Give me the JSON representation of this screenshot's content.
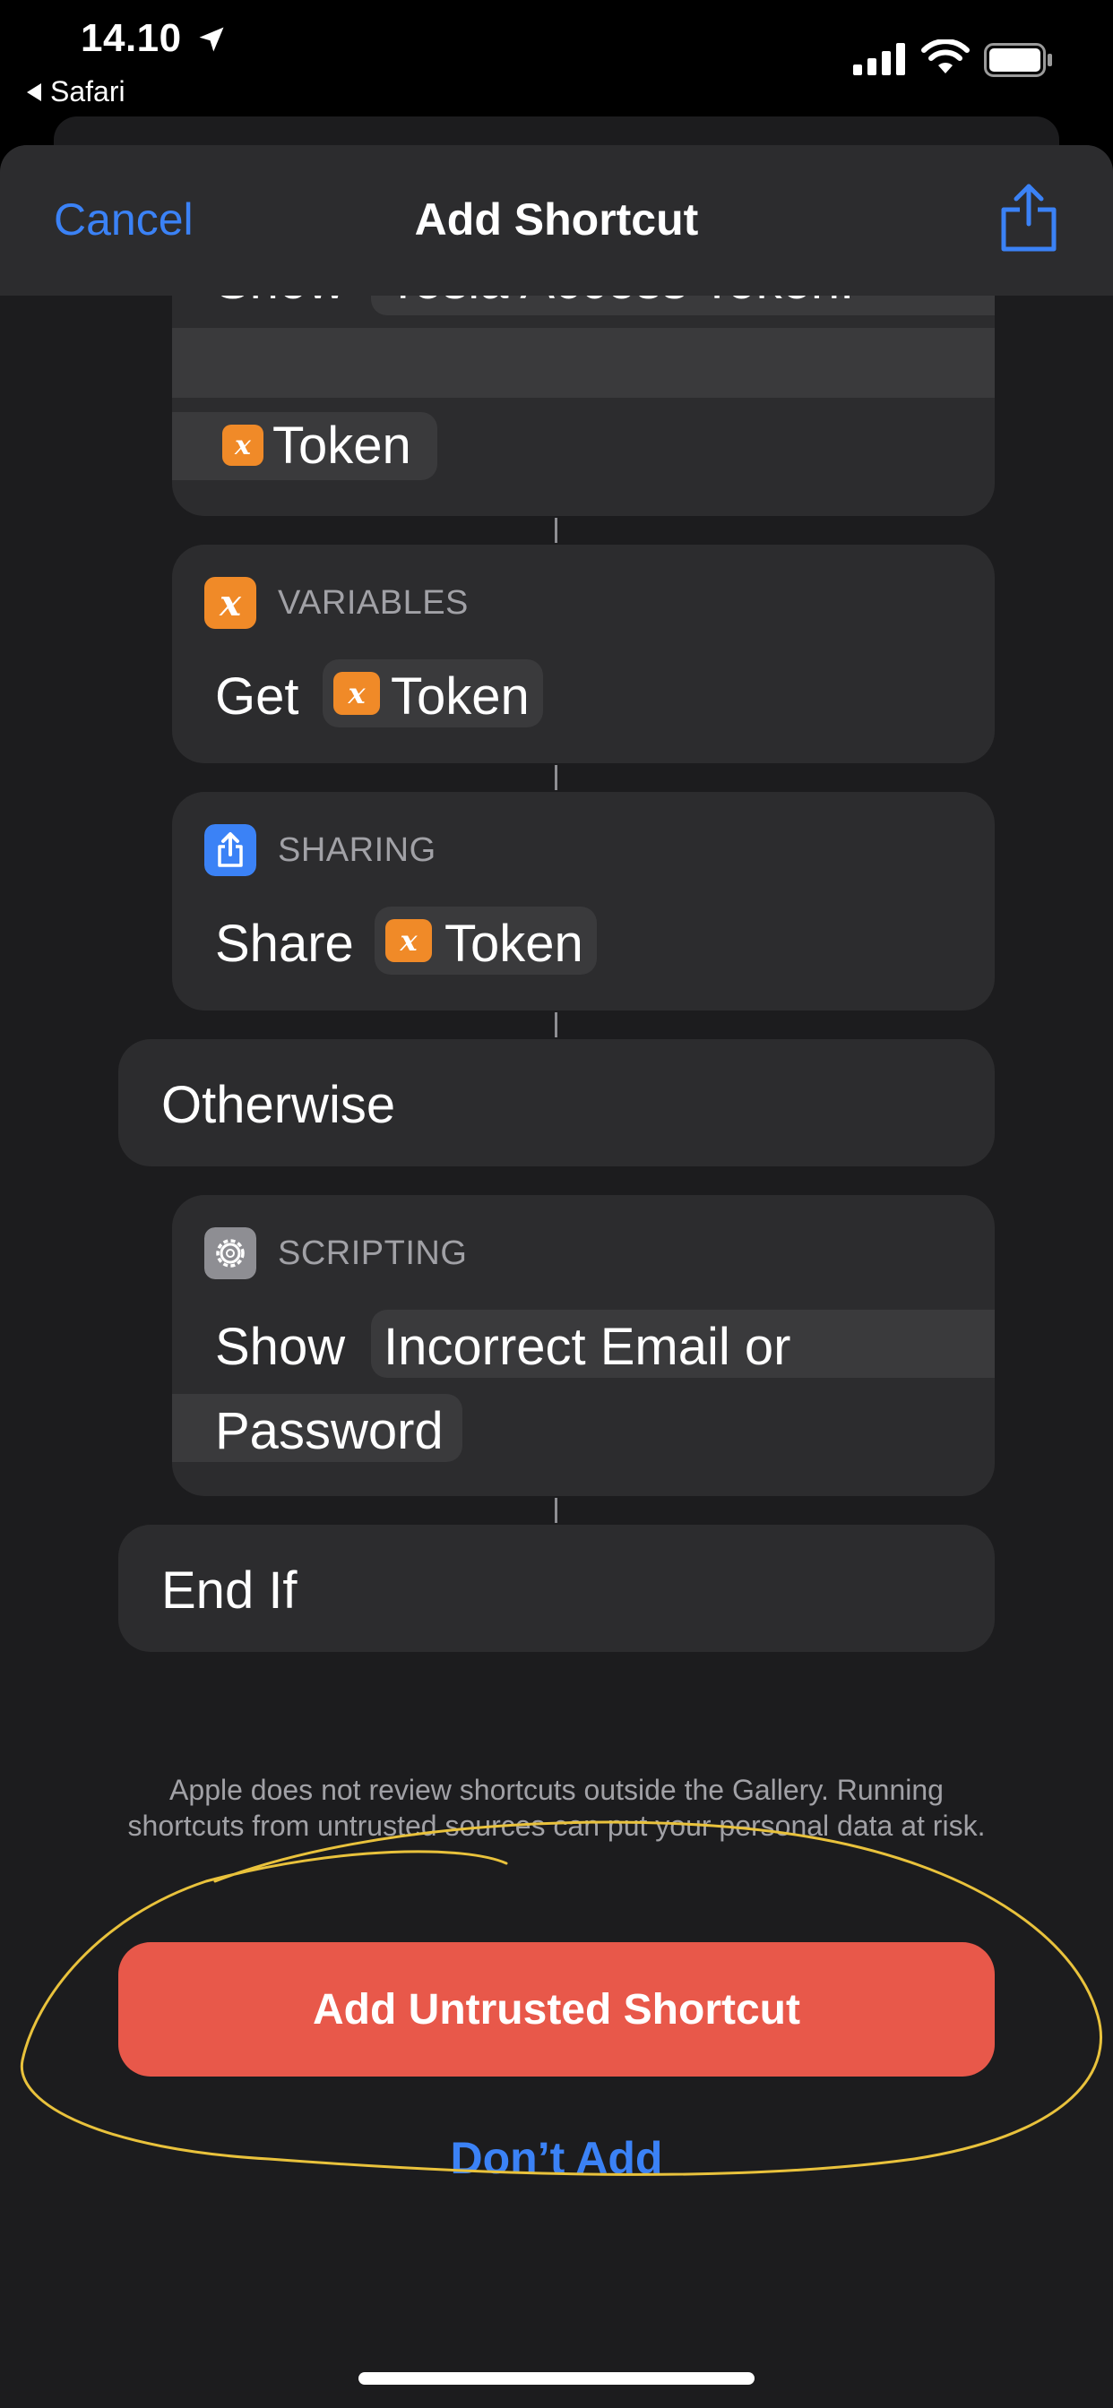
{
  "status_bar": {
    "time": "14.10",
    "back_app": "Safari"
  },
  "nav": {
    "cancel": "Cancel",
    "title": "Add Shortcut"
  },
  "partial_block": {
    "show_label": "Show",
    "show_value": "Tesla Access Token:",
    "token_label": "Token"
  },
  "variables_action": {
    "category": "VARIABLES",
    "verb": "Get",
    "token_label": "Token"
  },
  "sharing_action": {
    "category": "SHARING",
    "verb": "Share",
    "token_label": "Token"
  },
  "otherwise_block": {
    "label": "Otherwise"
  },
  "scripting_action": {
    "category": "SCRIPTING",
    "verb": "Show",
    "text_line1": "Incorrect Email or",
    "text_line2": "Password"
  },
  "end_if_block": {
    "label": "End If"
  },
  "notice": "Apple does not review shortcuts outside the Gallery. Running shortcuts from untrusted sources can put your personal data at risk.",
  "buttons": {
    "add_untrusted": "Add Untrusted Shortcut",
    "dont_add": "Don’t Add"
  },
  "icons": {
    "variable_glyph": "x",
    "location": "location-arrow-icon",
    "share": "share-icon",
    "gear": "gear-icon"
  },
  "colors": {
    "accent_blue": "#3b82f6",
    "danger_red": "#e8584a",
    "variable_orange": "#f08a28",
    "annotation_yellow": "#e9c23c"
  }
}
